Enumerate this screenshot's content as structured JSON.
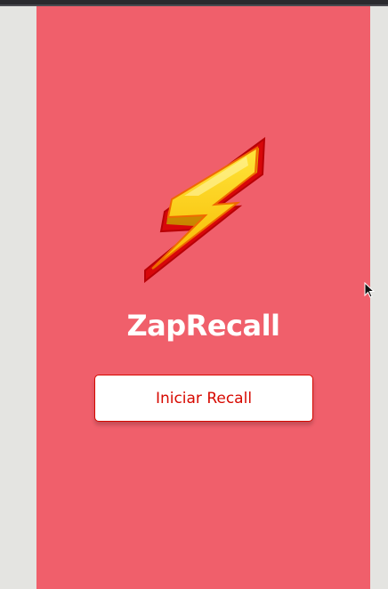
{
  "app": {
    "title": "ZapRecall",
    "logo_icon": "lightning-bolt-icon"
  },
  "start": {
    "button_label": "Iniciar Recall"
  },
  "colors": {
    "background": "#f05f6b",
    "button_text": "#d70900",
    "button_border": "#d70900",
    "title": "#ffffff",
    "page_side": "#e4e4e1"
  }
}
